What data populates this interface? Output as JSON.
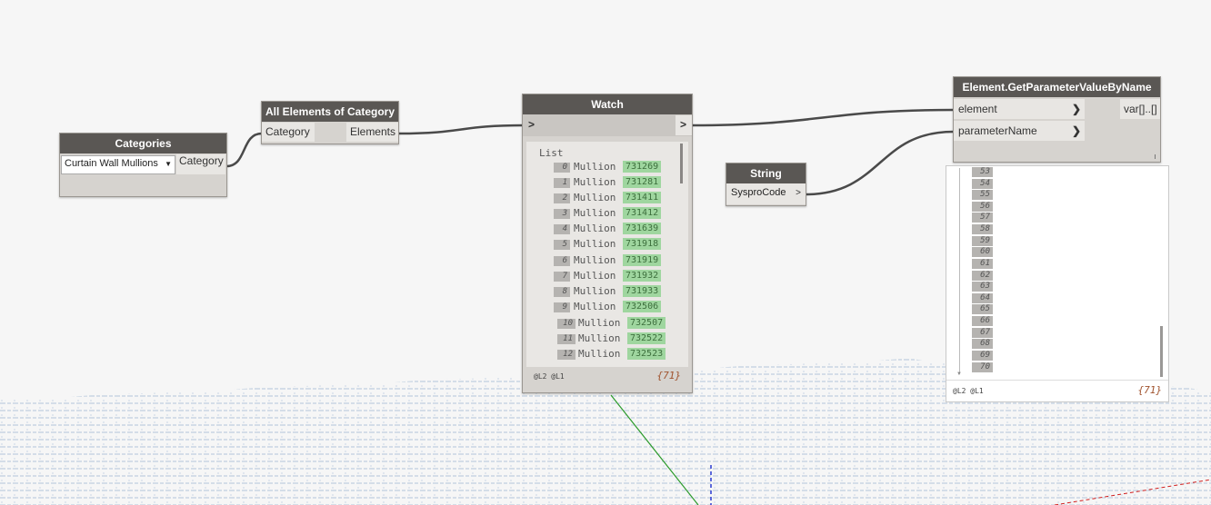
{
  "categories_node": {
    "title": "Categories",
    "dropdown_value": "Curtain Wall Mullions",
    "output_port": "Category"
  },
  "all_elements_node": {
    "title": "All Elements of Category",
    "input_port": "Category",
    "output_port": "Elements"
  },
  "watch_node": {
    "title": "Watch",
    "input_port": ">",
    "output_port": ">",
    "list_label": "List",
    "items": [
      {
        "index": "0",
        "type": "Mullion",
        "id": "731269"
      },
      {
        "index": "1",
        "type": "Mullion",
        "id": "731281"
      },
      {
        "index": "2",
        "type": "Mullion",
        "id": "731411"
      },
      {
        "index": "3",
        "type": "Mullion",
        "id": "731412"
      },
      {
        "index": "4",
        "type": "Mullion",
        "id": "731639"
      },
      {
        "index": "5",
        "type": "Mullion",
        "id": "731918"
      },
      {
        "index": "6",
        "type": "Mullion",
        "id": "731919"
      },
      {
        "index": "7",
        "type": "Mullion",
        "id": "731932"
      },
      {
        "index": "8",
        "type": "Mullion",
        "id": "731933"
      },
      {
        "index": "9",
        "type": "Mullion",
        "id": "732506"
      },
      {
        "index": "10",
        "type": "Mullion",
        "id": "732507"
      },
      {
        "index": "11",
        "type": "Mullion",
        "id": "732522"
      },
      {
        "index": "12",
        "type": "Mullion",
        "id": "732523"
      }
    ],
    "levels": "@L2 @L1",
    "count": "{71}"
  },
  "string_node": {
    "title": "String",
    "value": "SysproCode",
    "output_port": ">"
  },
  "get_param_node": {
    "title": "Element.GetParameterValueByName",
    "input_ports": [
      "element",
      "parameterName"
    ],
    "output_port": "var[]..[]"
  },
  "preview_bubble": {
    "indices": [
      "53",
      "54",
      "55",
      "56",
      "57",
      "58",
      "59",
      "60",
      "61",
      "62",
      "63",
      "64",
      "65",
      "66",
      "67",
      "68",
      "69",
      "70"
    ],
    "levels": "@L2 @L1",
    "count": "{71}"
  },
  "colors": {
    "title_bar": "#5a5754",
    "node_body": "#d6d3cf",
    "wire": "#4a4a4a",
    "value_bg": "#9fd69f",
    "grid": "#a9bfd6",
    "axis_green": "#2a9a2a",
    "axis_blue": "#2a3ad0",
    "axis_red": "#d02020"
  }
}
